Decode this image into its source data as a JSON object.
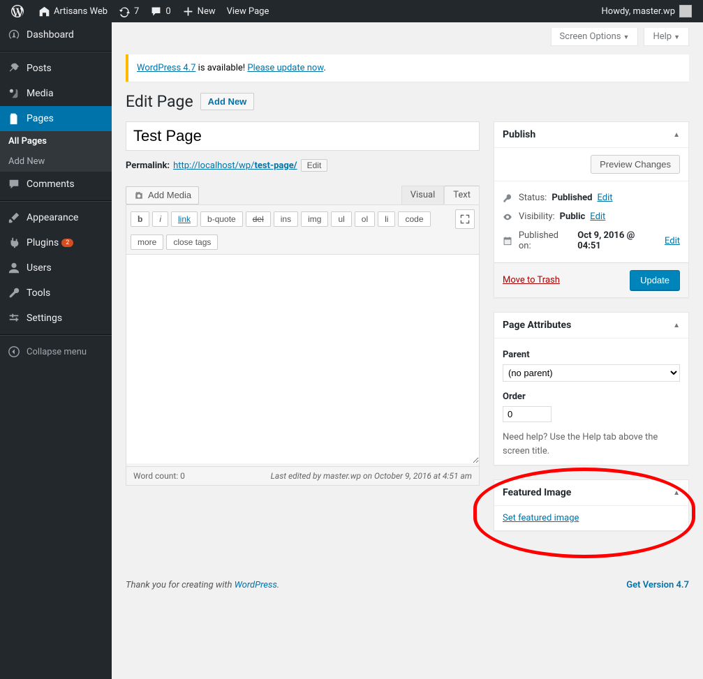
{
  "adminbar": {
    "site_name": "Artisans Web",
    "updates": "7",
    "comments": "0",
    "new": "New",
    "view_page": "View Page",
    "howdy": "Howdy, master.wp"
  },
  "sidebar": {
    "dashboard": "Dashboard",
    "posts": "Posts",
    "media": "Media",
    "pages": "Pages",
    "all_pages": "All Pages",
    "add_new": "Add New",
    "comments": "Comments",
    "appearance": "Appearance",
    "plugins": "Plugins",
    "plugins_badge": "2",
    "users": "Users",
    "tools": "Tools",
    "settings": "Settings",
    "collapse": "Collapse menu"
  },
  "screen_opts": {
    "label": "Screen Options",
    "help": "Help"
  },
  "notice": {
    "pre": "WordPress 4.7",
    "mid": " is available! ",
    "link": "Please update now",
    "post": "."
  },
  "heading": {
    "title": "Edit Page",
    "add_new": "Add New"
  },
  "editor": {
    "title_value": "Test Page",
    "permalink_label": "Permalink:",
    "permalink_base": "http://localhost/wp/",
    "permalink_slug": "test-page/",
    "edit": "Edit",
    "add_media": "Add Media",
    "tab_visual": "Visual",
    "tab_text": "Text",
    "qt": {
      "b": "b",
      "i": "i",
      "link": "link",
      "bquote": "b-quote",
      "del": "del",
      "ins": "ins",
      "img": "img",
      "ul": "ul",
      "ol": "ol",
      "li": "li",
      "code": "code",
      "more": "more",
      "close": "close tags"
    },
    "word_count": "Word count: 0",
    "last_edit": "Last edited by master.wp on October 9, 2016 at 4:51 am"
  },
  "publish": {
    "title": "Publish",
    "preview": "Preview Changes",
    "status_label": "Status:",
    "status_value": "Published",
    "visibility_label": "Visibility:",
    "visibility_value": "Public",
    "published_label": "Published on:",
    "published_value": "Oct 9, 2016 @ 04:51",
    "edit": "Edit",
    "trash": "Move to Trash",
    "update": "Update"
  },
  "attrs": {
    "title": "Page Attributes",
    "parent": "Parent",
    "parent_value": "(no parent)",
    "order": "Order",
    "order_value": "0",
    "help": "Need help? Use the Help tab above the screen title."
  },
  "featured": {
    "title": "Featured Image",
    "set": "Set featured image"
  },
  "footer": {
    "thank_pre": "Thank you for creating with ",
    "wp": "WordPress",
    "thank_post": ".",
    "version": "Get Version 4.7"
  }
}
